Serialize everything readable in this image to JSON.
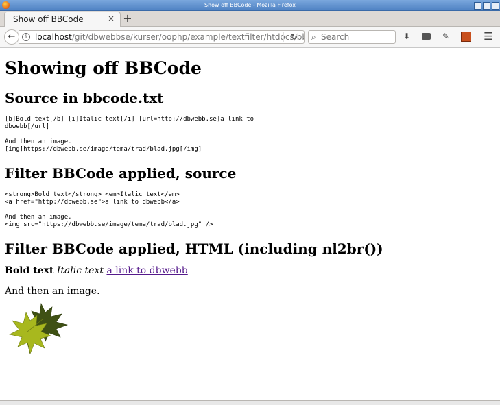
{
  "window": {
    "title": "Show off BBCode - Mozilla Firefox"
  },
  "tab": {
    "label": "Show off BBCode",
    "close": "×",
    "new_tab": "+"
  },
  "nav": {
    "back": "←",
    "url_host": "localhost",
    "url_path": "/git/dbwebbse/kurser/oophp/example/textfilter/htdocs/bbcode",
    "reload": "C",
    "search_placeholder": "Search"
  },
  "page": {
    "heading": "Showing off BBCode",
    "section_source": "Source in bbcode.txt",
    "source_text": "[b]Bold text[/b] [i]Italic text[/i] [url=http://dbwebb.se]a link to\ndbwebb[/url]\n\nAnd then an image.\n[img]https://dbwebb.se/image/tema/trad/blad.jpg[/img]",
    "section_filtered_source": "Filter BBCode applied, source",
    "filtered_source_text": "<strong>Bold text</strong> <em>Italic text</em>\n<a href=\"http://dbwebb.se\">a link to dbwebb</a>\n\nAnd then an image.\n<img src=\"https://dbwebb.se/image/tema/trad/blad.jpg\" />",
    "section_html": "Filter BBCode applied, HTML (including nl2br())",
    "bold_text": "Bold text",
    "italic_text": "Italic text",
    "link_text": "a link to dbwebb",
    "image_line": "And then an image."
  },
  "colors": {
    "link": "#551a8b",
    "leaf_light": "#a8b81e",
    "leaf_dark": "#3f5114"
  },
  "icons": [
    "firefox-icon",
    "info-icon",
    "reload-icon",
    "search-icon",
    "download-icon",
    "addon-icon",
    "eyedropper-icon",
    "extension-icon",
    "menu-icon"
  ]
}
